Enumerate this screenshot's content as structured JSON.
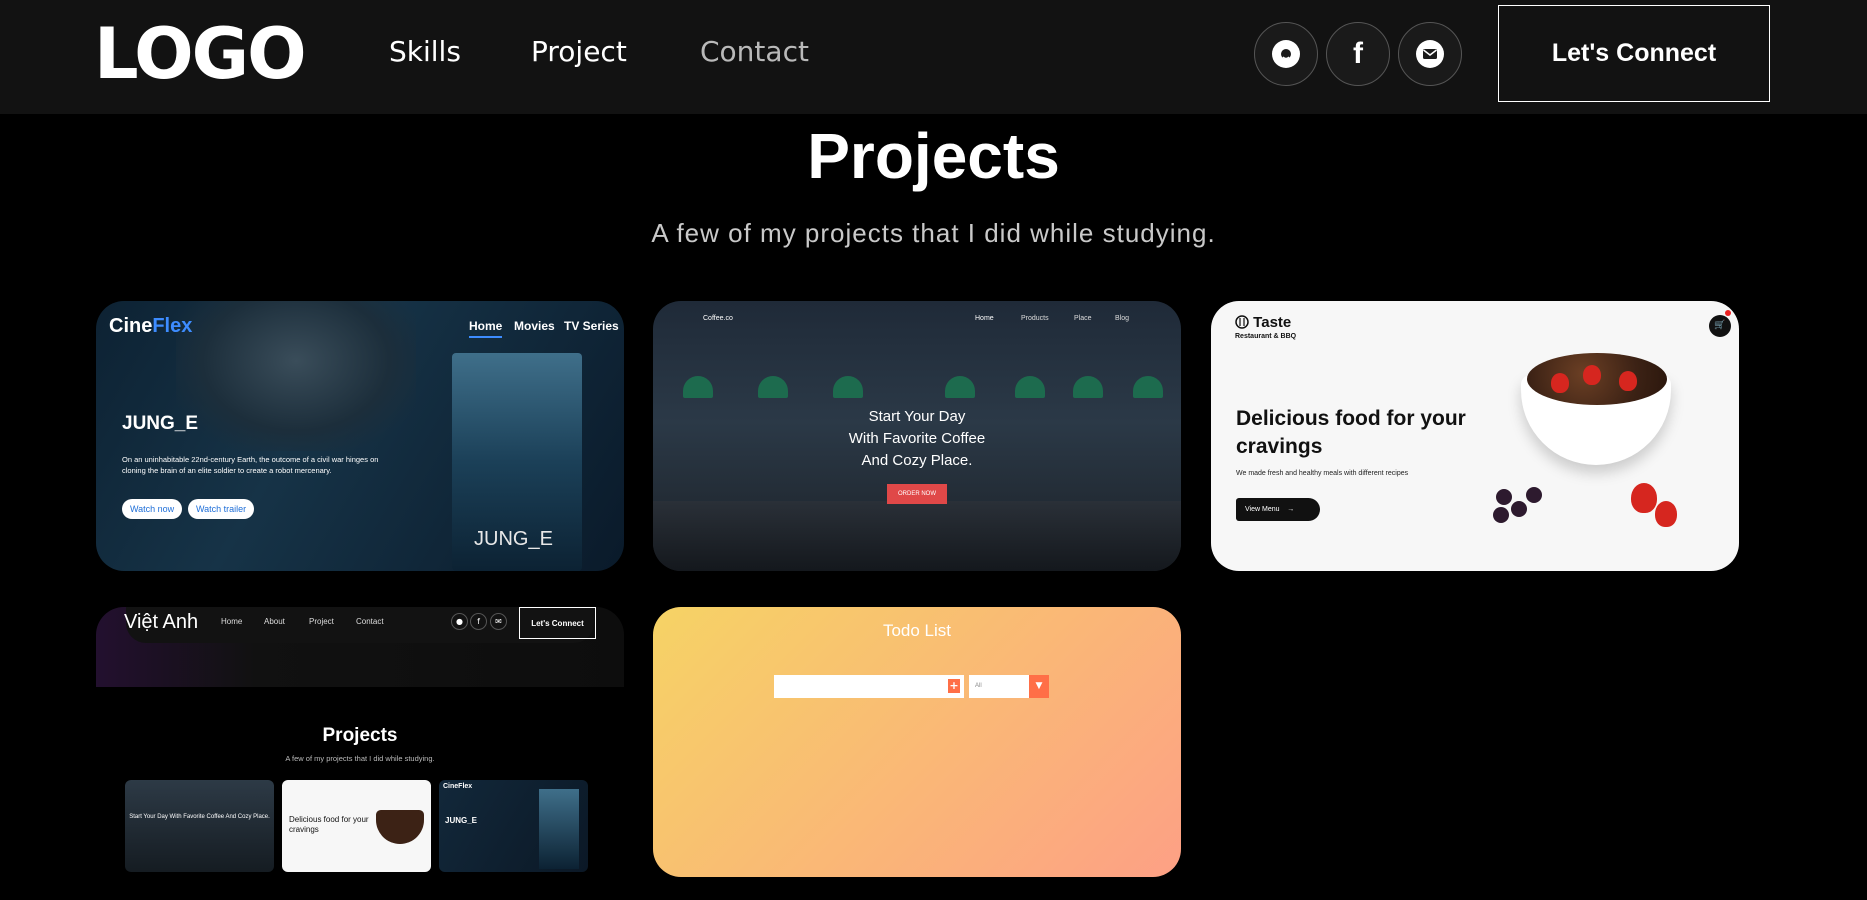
{
  "nav": {
    "logo": "LOGO",
    "links": [
      "Skills",
      "Project",
      "Contact"
    ],
    "social_icons": [
      "github-icon",
      "facebook-icon",
      "mail-icon"
    ],
    "facebook_glyph": "f",
    "connect_label": "Let's Connect"
  },
  "section": {
    "title": "Projects",
    "subtitle": "A few of my projects that I did while studying."
  },
  "projects": {
    "cineflex": {
      "brand_a": "Cine",
      "brand_b": "Flex",
      "menu": [
        "Home",
        "Movies",
        "TV Series"
      ],
      "title": "JUNG_E",
      "description": "On an uninhabitable 22nd-century Earth, the outcome of a civil war hinges on cloning the brain of an elite soldier to create a robot mercenary.",
      "watch_now": "Watch now",
      "watch_trailer": "Watch trailer",
      "poster_title": "JUNG_E",
      "accent": "#3d8cff"
    },
    "coffee": {
      "brand": "Coffee.co",
      "menu": [
        "Home",
        "Products",
        "Place",
        "Blog"
      ],
      "headline_1": "Start Your Day",
      "headline_2": "With Favorite Coffee",
      "headline_3": "And Cozy Place.",
      "order": "ORDER NOW",
      "accent": "#e04848"
    },
    "taste": {
      "brand": "Taste",
      "brand_sub": "Restaurant & BBQ",
      "headline": "Delicious food for your cravings",
      "sub": "We made fresh and healthy meals with different recipes",
      "view_menu": "View Menu"
    },
    "portfolio": {
      "brand": "Việt Anh",
      "menu": [
        "Home",
        "About",
        "Project",
        "Contact"
      ],
      "connect": "Let's Connect",
      "title": "Projects",
      "subtitle": "A few of my projects that I did while studying.",
      "thumb_coffee": "Start Your Day With Favorite Coffee And Cozy Place.",
      "thumb_taste": "Delicious food for your cravings",
      "thumb_cine_brand": "CineFlex",
      "thumb_cine_title": "JUNG_E"
    },
    "todo": {
      "title": "Todo List",
      "filter": "All",
      "gradient_start": "#f6d365",
      "gradient_end": "#fda085"
    }
  }
}
